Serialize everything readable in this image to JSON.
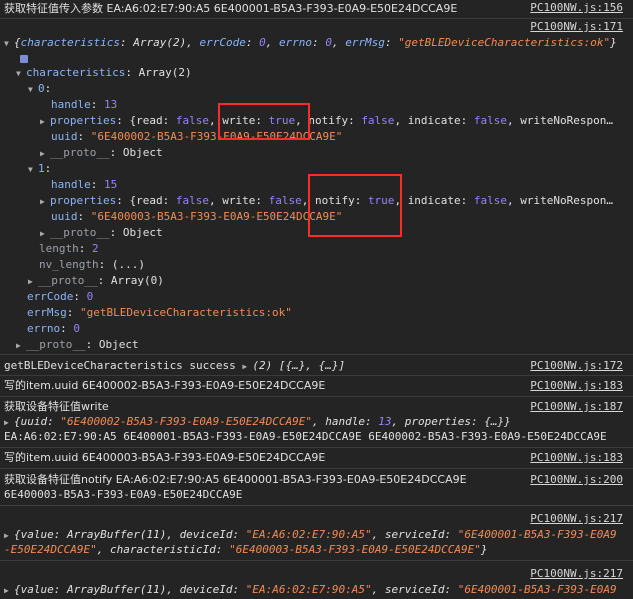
{
  "console": {
    "line1": {
      "text": "获取特征值传入参数 EA:A6:02:E7:90:A5 6E400001-B5A3-F393-E0A9-E50E24DCCA9E",
      "src": "PC100NW.js:156"
    },
    "obj_src": "PC100NW.js:171",
    "obj_summary": {
      "open": "{",
      "characteristics_label": "characteristics",
      "characteristics_value": "Array(2)",
      "errCode_label": "errCode",
      "errCode_value": "0",
      "errno_label": "errno",
      "errno_value": "0",
      "errMsg_label": "errMsg",
      "errMsg_value": "\"getBLEDeviceCharacteristics:ok\"",
      "close": "}"
    },
    "tree": {
      "characteristics_label": "characteristics",
      "characteristics_type": "Array(2)",
      "item0_index": "0",
      "item0_handle_label": "handle",
      "item0_handle_value": "13",
      "item0_properties_label": "properties",
      "item0_properties_value_pre": "{read: ",
      "item0_read": "false",
      "item0_write_label": "write: ",
      "item0_write": "true",
      "item0_notify_label": "notify: ",
      "item0_notify": "false",
      "item0_indicate_label": "indicate: ",
      "item0_indicate": "false",
      "item0_wnr": "writeNoRespon…",
      "item0_uuid_label": "uuid",
      "item0_uuid_value": "\"6E400002-B5A3-F393-E0A9-E50E24DCCA9E\"",
      "proto_label": "__proto__",
      "proto_object": "Object",
      "item1_index": "1",
      "item1_handle_label": "handle",
      "item1_handle_value": "15",
      "item1_properties_label": "properties",
      "item1_read": "false",
      "item1_write_label": "write: ",
      "item1_write": "false",
      "item1_notify_label": "notify: ",
      "item1_notify": "true",
      "item1_indicate_label": "indicate: ",
      "item1_indicate": "false",
      "item1_wnr": "writeNoRespon…",
      "item1_uuid_label": "uuid",
      "item1_uuid_value": "\"6E400003-B5A3-F393-E0A9-E50E24DCCA9E\"",
      "length_label": "length",
      "length_value": "2",
      "nv_length_label": "nv_length",
      "nv_length_value": "(...)",
      "array_proto_label": "__proto__",
      "array_proto_value": "Array(0)",
      "errCode_label": "errCode",
      "errCode_value": "0",
      "errMsg_label": "errMsg",
      "errMsg_value": "\"getBLEDeviceCharacteristics:ok\"",
      "errno_label": "errno",
      "errno_value": "0",
      "root_proto_label": "__proto__",
      "root_proto_value": "Object"
    },
    "line_success": {
      "text": "getBLEDeviceCharacteristics success ",
      "extra": "(2) [{…}, {…}]",
      "src": "PC100NW.js:172"
    },
    "line_write_uuid": {
      "text": "写的item.uuid 6E400002-B5A3-F393-E0A9-E50E24DCCA9E",
      "src": "PC100NW.js:183"
    },
    "line_get_write": {
      "text": "获取设备特征值write",
      "src": "PC100NW.js:187",
      "obj_pre": "{uuid: ",
      "obj_uuid": "\"6E400002-B5A3-F393-E0A9-E50E24DCCA9E\"",
      "obj_mid": ", handle: ",
      "obj_handle": "13",
      "obj_post": ", properties: {…}}",
      "line2": "EA:A6:02:E7:90:A5 6E400001-B5A3-F393-E0A9-E50E24DCCA9E 6E400002-B5A3-F393-E0A9-E50E24DCCA9E"
    },
    "line_write_uuid2": {
      "text": "写的item.uuid 6E400003-B5A3-F393-E0A9-E50E24DCCA9E",
      "src": "PC100NW.js:183"
    },
    "line_get_notify": {
      "text": "获取设备特征值notify EA:A6:02:E7:90:A5 6E400001-B5A3-F393-E0A9-E50E24DCCA9E",
      "line2": "6E400003-B5A3-F393-E0A9-E50E24DCCA9E",
      "src": "PC100NW.js:200"
    },
    "line_value1": {
      "src": "PC100NW.js:217",
      "pre": "{value: ArrayBuffer(11), deviceId: ",
      "device": "\"EA:A6:02:E7:90:A5\"",
      "mid": ", serviceId: ",
      "service_a": "\"6E400001-B5A3-F393-E0A9",
      "service_b": "-E50E24DCCA9E\"",
      "mid2": ", characteristicId: ",
      "char": "\"6E400003-B5A3-F393-E0A9-E50E24DCCA9E\"",
      "close": "}"
    },
    "line_value2": {
      "src": "PC100NW.js:217",
      "pre": "{value: ArrayBuffer(11), deviceId: ",
      "device": "\"EA:A6:02:E7:90:A5\"",
      "mid": ", serviceId: ",
      "service_a": "\"6E400001-B5A3-F393-E0A9"
    }
  },
  "colors": {
    "highlight_box": "#ff2a2a",
    "background": "#242424"
  }
}
